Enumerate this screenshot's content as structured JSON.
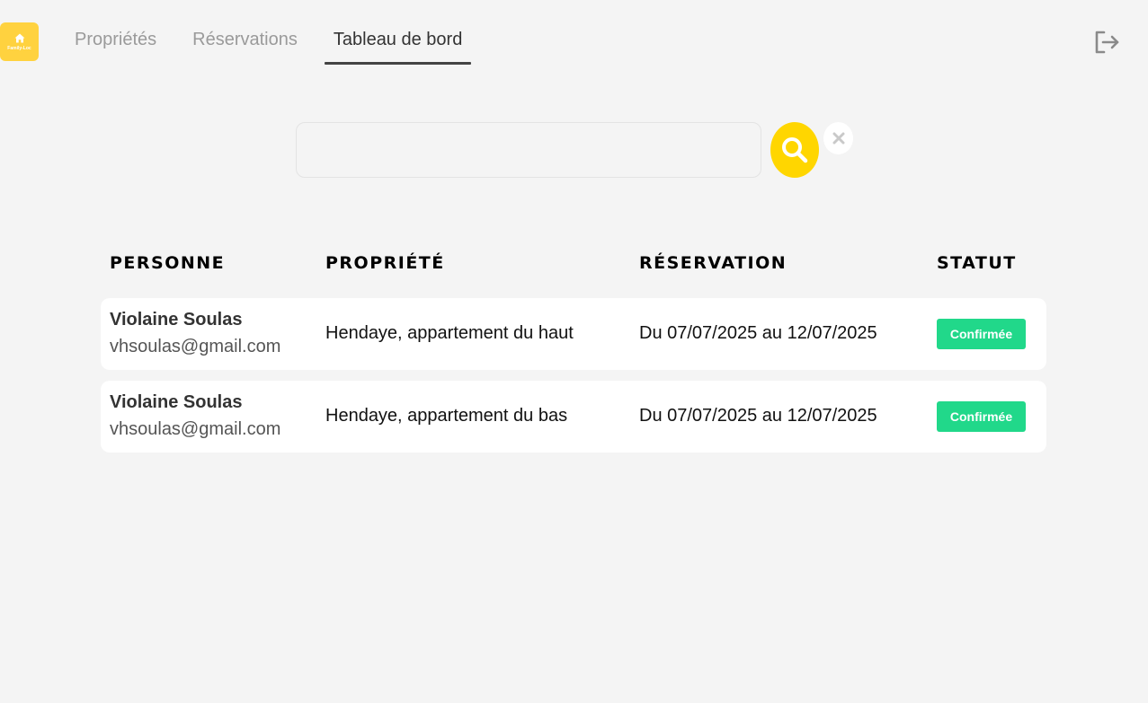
{
  "app": {
    "logo_text": "Family-Loc",
    "colors": {
      "accent": "#ffd600",
      "logo_bg": "#ffd23f",
      "status_confirmed": "#21d88a",
      "background": "#f4f4f4"
    }
  },
  "nav": {
    "tabs": [
      {
        "label": "Propriétés",
        "active": false
      },
      {
        "label": "Réservations",
        "active": false
      },
      {
        "label": "Tableau de bord",
        "active": true
      }
    ],
    "logout_icon": "logout-icon"
  },
  "search": {
    "value": "",
    "placeholder": "",
    "search_icon": "search-icon",
    "clear_icon": "close-icon"
  },
  "table": {
    "headers": [
      "PERSONNE",
      "PROPRIÉTÉ",
      "RÉSERVATION",
      "STATUT"
    ],
    "rows": [
      {
        "name": "Violaine Soulas",
        "email": "vhsoulas@gmail.com",
        "property": "Hendaye, appartement du haut",
        "reservation": "Du 07/07/2025 au 12/07/2025",
        "status": "Confirmée"
      },
      {
        "name": "Violaine Soulas",
        "email": "vhsoulas@gmail.com",
        "property": "Hendaye, appartement du bas",
        "reservation": "Du 07/07/2025 au 12/07/2025",
        "status": "Confirmée"
      }
    ]
  }
}
